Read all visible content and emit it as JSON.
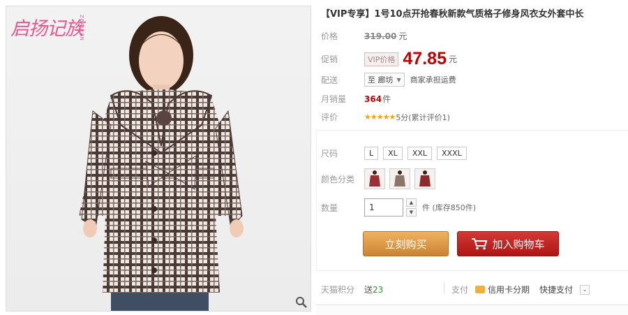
{
  "image": {
    "brand_text": "启扬记族",
    "brand_sub": "ZEALYEN",
    "zoom_icon": "magnifier-icon"
  },
  "product": {
    "title": "【VIP专享】1号10点开抢春秋新款气质格子修身风衣女外套中长"
  },
  "price": {
    "label": "价格",
    "original": "319.00",
    "unit": "元"
  },
  "promo": {
    "label": "促销",
    "tag": "VIP价格",
    "value": "47.85",
    "unit": "元"
  },
  "shipping": {
    "label": "配送",
    "destination": "至 廊坊",
    "note": "商家承担运费"
  },
  "sales": {
    "label": "月销量",
    "count": "364",
    "unit": "件"
  },
  "rating": {
    "label": "评价",
    "stars": "★★★★★",
    "text": "5分(累计评价1)"
  },
  "size": {
    "label": "尺码",
    "options": [
      "L",
      "XL",
      "XXL",
      "XXXL"
    ]
  },
  "color": {
    "label": "颜色分类",
    "swatches": [
      "#9b2f36",
      "#8a7568",
      "#8d2a2a"
    ]
  },
  "quantity": {
    "label": "数量",
    "value": "1",
    "up": "▲",
    "down": "▼",
    "stock": "件 (库存850件)"
  },
  "buttons": {
    "buy": "立刻购买",
    "cart": "加入购物车"
  },
  "footer": {
    "points_label": "天猫积分",
    "points_prefix": "送",
    "points_value": "23",
    "pay_label": "支付",
    "pay_card": "信用卡分期",
    "pay_quick": "快捷支付",
    "dropdown": "⌄"
  },
  "colors": {
    "accent_red": "#c40000",
    "buy_orange": "#cd8235",
    "cart_red": "#ae1513",
    "star": "#f6a304"
  }
}
